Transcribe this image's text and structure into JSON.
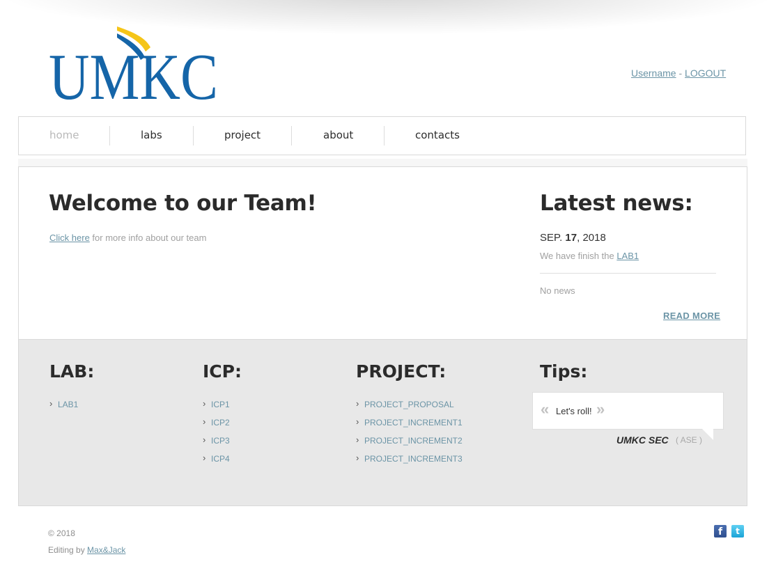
{
  "header": {
    "logo_text": "UMKC",
    "username": "Username",
    "separator": "-",
    "logout": "LOGOUT"
  },
  "nav": {
    "items": [
      {
        "label": "home",
        "active": true
      },
      {
        "label": "labs",
        "active": false
      },
      {
        "label": "project",
        "active": false
      },
      {
        "label": "about",
        "active": false
      },
      {
        "label": "contacts",
        "active": false
      }
    ]
  },
  "welcome": {
    "title": "Welcome to our Team!",
    "link_text": "Click here",
    "text": " for more info about our team"
  },
  "news": {
    "title": "Latest news:",
    "month": "SEP.",
    "day": "17",
    "year": ", 2018",
    "item_text": "We have finish the ",
    "item_link": "LAB1",
    "empty_text": "No news",
    "read_more": "READ MORE"
  },
  "lab": {
    "title": "LAB:",
    "links": [
      "LAB1"
    ]
  },
  "icp": {
    "title": "ICP:",
    "links": [
      "ICP1",
      "ICP2",
      "ICP3",
      "ICP4"
    ]
  },
  "project": {
    "title": "PROJECT:",
    "links": [
      "PROJECT_PROPOSAL",
      "PROJECT_INCREMENT1",
      "PROJECT_INCREMENT2",
      "PROJECT_INCREMENT3"
    ]
  },
  "tips": {
    "title": "Tips:",
    "open_quote": "«",
    "close_quote": "»",
    "text": "Let's roll!",
    "author": "UMKC SEC",
    "role": "( ASE )"
  },
  "footer": {
    "copyright": "© 2018",
    "editing_prefix": "Editing by ",
    "editing_link": "Max&Jack"
  },
  "social": {
    "facebook": "f",
    "twitter": "t"
  },
  "colors": {
    "logo_blue": "#1565a8",
    "logo_gold": "#f5c518",
    "link": "#6b94a6",
    "panel_bg": "#e8e8e8"
  }
}
